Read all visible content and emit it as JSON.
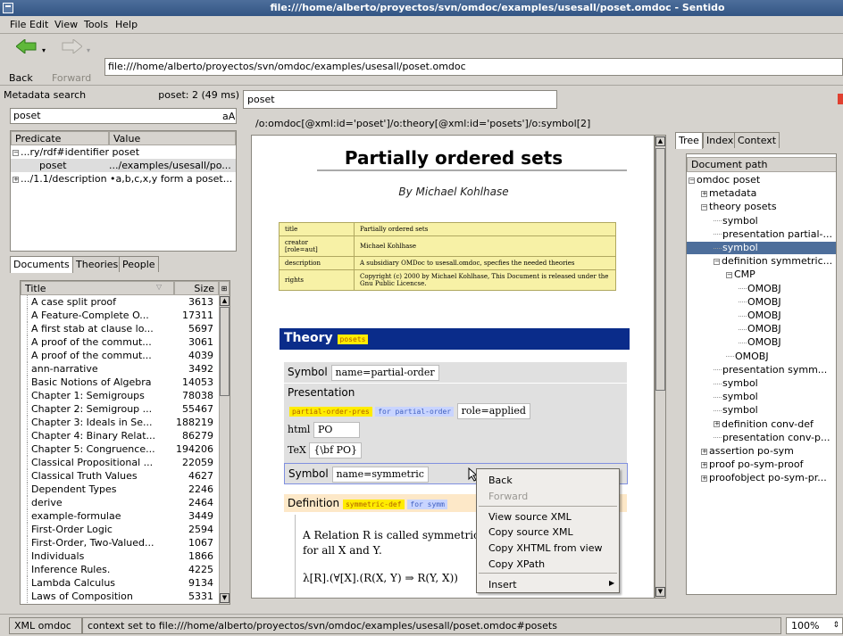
{
  "window": {
    "title": "file:///home/alberto/proyectos/svn/omdoc/examples/usesall/poset.omdoc - Sentido"
  },
  "menu": [
    "File",
    "Edit",
    "View",
    "Tools",
    "Help"
  ],
  "toolbar": {
    "back": "Back",
    "forward": "Forward",
    "url": "file:///home/alberto/proyectos/svn/omdoc/examples/usesall/poset.omdoc"
  },
  "metadata": {
    "label": "Metadata search",
    "status": "poset: 2 (49 ms)",
    "query": "poset",
    "case": "aA",
    "col_predicate": "Predicate",
    "col_value": "Value",
    "rows": [
      {
        "text": "...ry/rdf#identifier poset"
      },
      {
        "pred": "poset",
        "value": ".../examples/usesall/po..."
      },
      {
        "text": ".../1.1/description •a,b,c,x,y form a poset..."
      }
    ]
  },
  "lefttabs": [
    "Documents",
    "Theories",
    "People"
  ],
  "docs": {
    "col_title": "Title",
    "col_size": "Size",
    "items": [
      [
        "A case split proof",
        "3613"
      ],
      [
        "A Feature-Complete O...",
        "17311"
      ],
      [
        "A first stab at clause lo...",
        "5697"
      ],
      [
        "A proof of the commut...",
        "3061"
      ],
      [
        "A proof of the commut...",
        "4039"
      ],
      [
        "ann-narrative",
        "3492"
      ],
      [
        "Basic Notions of Algebra",
        "14053"
      ],
      [
        "Chapter 1: Semigroups",
        "78038"
      ],
      [
        "Chapter 2: Semigroup ...",
        "55467"
      ],
      [
        "Chapter 3: Ideals in  Se...",
        "188219"
      ],
      [
        "Chapter 4: Binary Relat...",
        "86279"
      ],
      [
        "Chapter 5: Congruence...",
        "194206"
      ],
      [
        "Classical Propositional ...",
        "22059"
      ],
      [
        "Classical Truth Values",
        "4627"
      ],
      [
        "Dependent Types",
        "2246"
      ],
      [
        "derive",
        "2464"
      ],
      [
        "example-formulae",
        "3449"
      ],
      [
        "First-Order Logic",
        "2594"
      ],
      [
        "First-Order, Two-Valued...",
        "1067"
      ],
      [
        "Individuals",
        "1866"
      ],
      [
        "Inference Rules.",
        "4225"
      ],
      [
        "Lambda Calculus",
        "9134"
      ],
      [
        "Laws of Composition",
        "5331"
      ]
    ]
  },
  "center": {
    "tab": "poset",
    "path": "/o:omdoc[@xml:id='poset']/o:theory[@xml:id='posets']/o:symbol[2]"
  },
  "document": {
    "title": "Partially ordered sets",
    "author": "By Michael Kohlhase",
    "meta": [
      [
        "title",
        "Partially ordered sets"
      ],
      [
        "creator\n[role=aut]",
        "Michael Kohlhase"
      ],
      [
        "description",
        "A subsidiary OMDoc to usesall.omdoc, specfies the needed theories"
      ],
      [
        "rights",
        "Copyright (c) 2000 by Michael Kohlhase, This Document is released under the Gnu Public Licencse."
      ]
    ],
    "theory_label": "Theory",
    "theory_tag": "posets",
    "symbol1_label": "Symbol",
    "symbol1_name": "name=partial-order",
    "presentation_label": "Presentation",
    "pres_tag": "partial-order-pres",
    "pres_for": "for partial-order",
    "pres_role": "role=applied",
    "html_label": "html",
    "html_val": "PO",
    "tex_label": "TeX",
    "tex_val": "{\\bf PO}",
    "symbol2_label": "Symbol",
    "symbol2_name": "name=symmetric",
    "def_label": "Definition",
    "def_tag": "symmetric-def",
    "def_for": "for symm",
    "def_text1": "A Relation R is called symmetric, if",
    "def_text2": "for all X and Y.",
    "formula": "λ[R].(∀[X].(R(X, Y) ⇒ R(Y, X))"
  },
  "righttabs": [
    "Tree",
    "Index",
    "Context"
  ],
  "tree": {
    "header": "Document path",
    "items": [
      {
        "t": "omdoc poset",
        "l": 0,
        "e": "-"
      },
      {
        "t": "metadata",
        "l": 1,
        "e": "+"
      },
      {
        "t": "theory posets",
        "l": 1,
        "e": "-"
      },
      {
        "t": "symbol",
        "l": 2,
        "e": ""
      },
      {
        "t": "presentation partial-...",
        "l": 2,
        "e": ""
      },
      {
        "t": "symbol",
        "l": 2,
        "e": "",
        "s": true
      },
      {
        "t": "definition symmetric...",
        "l": 2,
        "e": "-"
      },
      {
        "t": "CMP",
        "l": 3,
        "e": "-"
      },
      {
        "t": "OMOBJ",
        "l": 4,
        "e": ""
      },
      {
        "t": "OMOBJ",
        "l": 4,
        "e": ""
      },
      {
        "t": "OMOBJ",
        "l": 4,
        "e": ""
      },
      {
        "t": "OMOBJ",
        "l": 4,
        "e": ""
      },
      {
        "t": "OMOBJ",
        "l": 4,
        "e": ""
      },
      {
        "t": "OMOBJ",
        "l": 3,
        "e": ""
      },
      {
        "t": "presentation symm...",
        "l": 2,
        "e": ""
      },
      {
        "t": "symbol",
        "l": 2,
        "e": ""
      },
      {
        "t": "symbol",
        "l": 2,
        "e": ""
      },
      {
        "t": "symbol",
        "l": 2,
        "e": ""
      },
      {
        "t": "definition conv-def",
        "l": 2,
        "e": "+"
      },
      {
        "t": "presentation conv-p...",
        "l": 2,
        "e": ""
      },
      {
        "t": "assertion po-sym",
        "l": 1,
        "e": "+"
      },
      {
        "t": "proof po-sym-proof",
        "l": 1,
        "e": "+"
      },
      {
        "t": "proofobject po-sym-pr...",
        "l": 1,
        "e": "+"
      }
    ]
  },
  "context_menu": {
    "items": [
      "Back",
      "Forward",
      "View source XML",
      "Copy source XML",
      "Copy XHTML from view",
      "Copy XPath",
      "Insert"
    ]
  },
  "status": {
    "mode": "XML omdoc",
    "message": "context set to file:///home/alberto/proyectos/svn/omdoc/examples/usesall/poset.omdoc#posets",
    "zoom": "100%"
  }
}
